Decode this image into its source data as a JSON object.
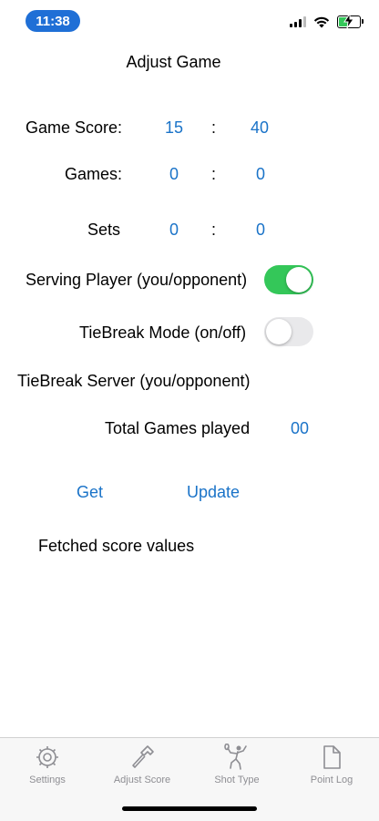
{
  "status": {
    "time": "11:38"
  },
  "header": {
    "title": "Adjust Game"
  },
  "score": {
    "game_score_label": "Game Score:",
    "game_you": "15",
    "game_opp": "40",
    "games_label": "Games:",
    "games_you": "0",
    "games_opp": "0",
    "sets_label": "Sets",
    "sets_you": "0",
    "sets_opp": "0",
    "separator": ":"
  },
  "toggles": {
    "serving_label": "Serving Player (you/opponent)",
    "serving_on": true,
    "tiebreak_label": "TieBreak Mode (on/off)",
    "tiebreak_on": false
  },
  "tiebreak_server_label": "TieBreak Server (you/opponent)",
  "total_games": {
    "label": "Total Games played",
    "value": "00"
  },
  "actions": {
    "get_label": "Get",
    "update_label": "Update"
  },
  "fetched_label": "Fetched score values",
  "tabbar": {
    "tabs": [
      {
        "label": "Settings",
        "icon": "gear-icon"
      },
      {
        "label": "Adjust Score",
        "icon": "hammer-icon"
      },
      {
        "label": "Shot Type",
        "icon": "tennis-player-icon"
      },
      {
        "label": "Point Log",
        "icon": "document-icon"
      }
    ]
  },
  "colors": {
    "accent": "#1a73c8",
    "toggle_on": "#34c759",
    "time_pill": "#1f6fd6"
  }
}
